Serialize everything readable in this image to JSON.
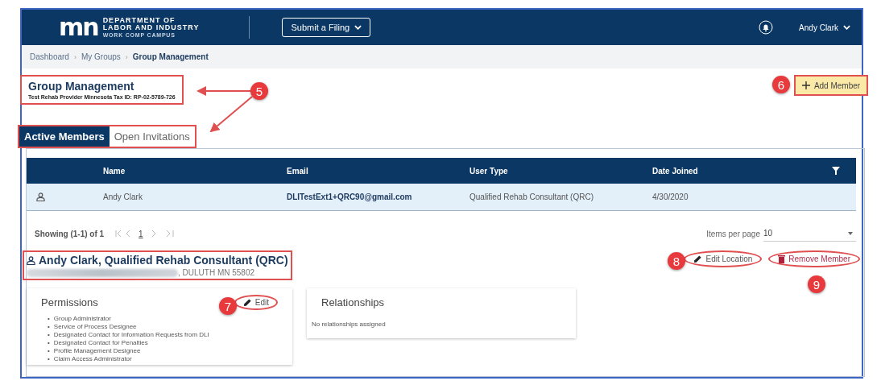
{
  "header": {
    "logo_mark": "mn",
    "logo_lines": [
      "DEPARTMENT OF",
      "LABOR AND INDUSTRY",
      "WORK COMP CAMPUS"
    ],
    "submit_button": "Submit a Filing",
    "user": "Andy Clark"
  },
  "breadcrumb_separator": "›",
  "breadcrumb": [
    {
      "label": "Dashboard",
      "current": false
    },
    {
      "label": "My Groups",
      "current": false
    },
    {
      "label": "Group Management",
      "current": true
    }
  ],
  "page": {
    "title": "Group Management",
    "subtitle": "Test Rehab Provider Minnesota Tax ID: RP-02-5789-726",
    "add_button": "Add Member"
  },
  "tabs": [
    {
      "label": "Active Members",
      "selected": true
    },
    {
      "label": "Open Invitations",
      "selected": false
    }
  ],
  "table": {
    "columns": [
      "Name",
      "Email",
      "User Type",
      "Date Joined"
    ],
    "rows": [
      {
        "name": "Andy Clark",
        "email": "DLITestExt1+QRC90@gmail.com",
        "user_type": "Qualified Rehab Consultant (QRC)",
        "date_joined": "4/30/2020",
        "selected": true
      }
    ]
  },
  "pagination": {
    "showing": "Showing (1-1) of 1",
    "page": "1",
    "items_label": "Items per page",
    "items_value": "10"
  },
  "member": {
    "title": "Andy Clark, Qualified Rehab Consultant (QRC)",
    "address": ", DULUTH MN 55802",
    "edit_location": "Edit Location",
    "remove": "Remove Member"
  },
  "permissions": {
    "title": "Permissions",
    "bullet": "•",
    "edit": "Edit",
    "items": [
      "Group Administrator",
      "Service of Process Designee",
      "Designated Contact for Information Requests from DLI",
      "Designated Contact for Penalties",
      "Profile Management Designee",
      "Claim Access Administrator"
    ]
  },
  "relationships": {
    "title": "Relationships",
    "empty": "No relationships assigned"
  },
  "callouts": [
    "5",
    "6",
    "7",
    "8",
    "9"
  ]
}
